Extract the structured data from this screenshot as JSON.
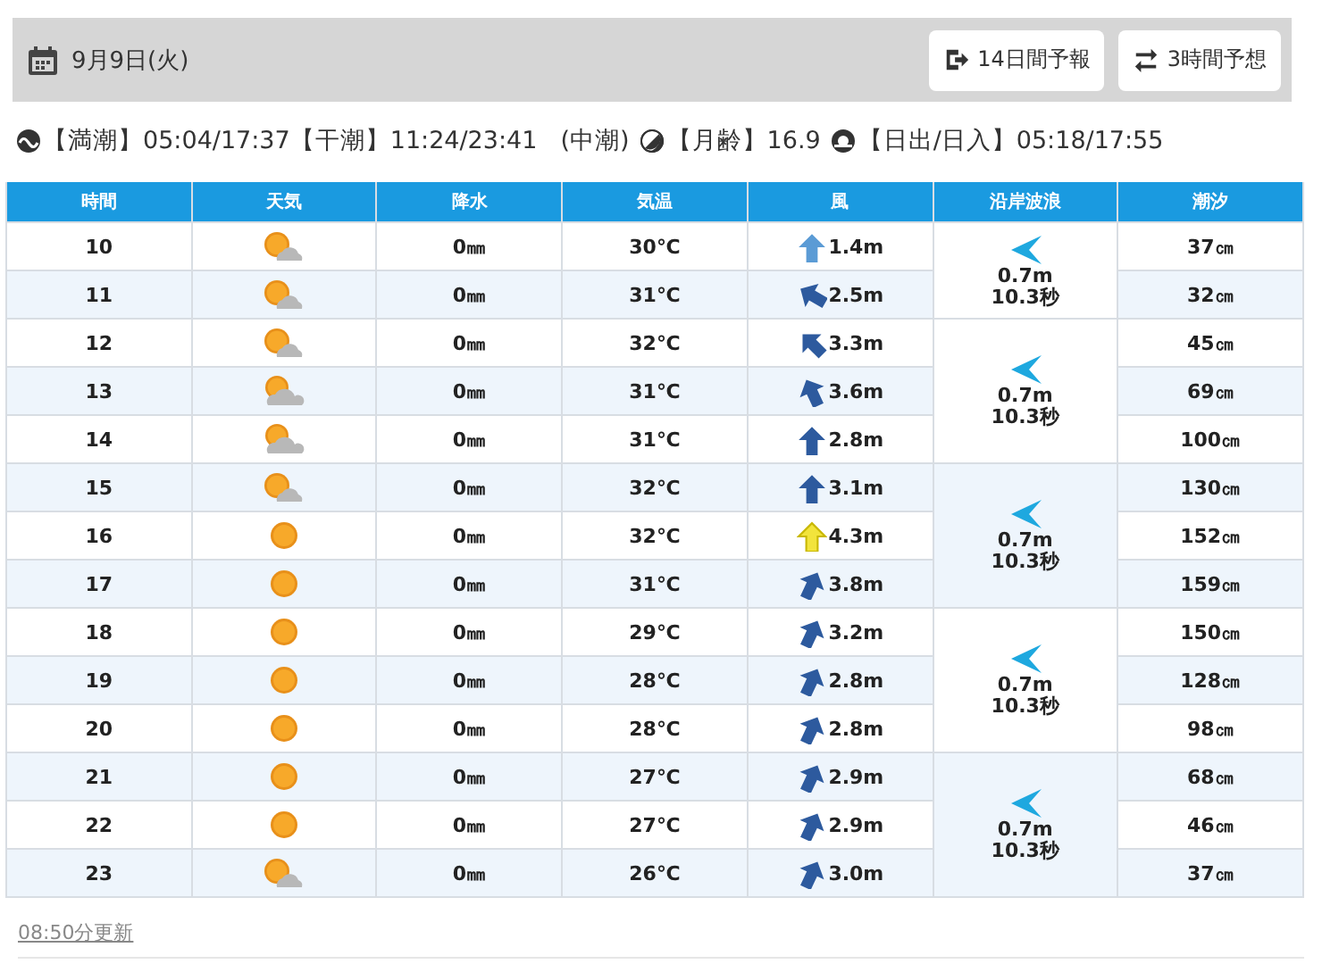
{
  "header": {
    "date": "9月9日(火)",
    "buttons": [
      {
        "label": "14日間予報",
        "kind": "exit"
      },
      {
        "label": "3時間予想",
        "kind": "swap"
      }
    ]
  },
  "tide_info": [
    {
      "kind": "tide",
      "texts": [
        "【満潮】05:04/17:37【干潮】11:24/23:41",
        "(中潮)"
      ]
    },
    {
      "kind": "moon",
      "texts": [
        "【月齢】16.9"
      ]
    },
    {
      "kind": "sun",
      "texts": [
        "【日出/日入】05:18/17:55"
      ]
    }
  ],
  "table": {
    "columns": [
      "時間",
      "天気",
      "降水",
      "気温",
      "風",
      "沿岸波浪",
      "潮汐"
    ],
    "wave_groups": [
      {
        "height": "0.7m",
        "period": "10.3秒",
        "rows": [
          {
            "time": "10",
            "kind": "suncloud",
            "rain": "0㎜",
            "temp": "30℃",
            "wind": {
              "kind": "n",
              "color": "#5b9bd5",
              "speed": "1.4m"
            },
            "tide": "37㎝"
          },
          {
            "time": "11",
            "kind": "suncloud",
            "rain": "0㎜",
            "temp": "31℃",
            "wind": {
              "kind": "wnw",
              "color": "#2d5a9e",
              "speed": "2.5m"
            },
            "tide": "32㎝"
          }
        ]
      },
      {
        "height": "0.7m",
        "period": "10.3秒",
        "rows": [
          {
            "time": "12",
            "kind": "suncloud",
            "rain": "0㎜",
            "temp": "32℃",
            "wind": {
              "kind": "nw",
              "color": "#2d5a9e",
              "speed": "3.3m"
            },
            "tide": "45㎝"
          },
          {
            "time": "13",
            "kind": "cloudsun",
            "rain": "0㎜",
            "temp": "31℃",
            "wind": {
              "kind": "nnw",
              "color": "#2d5a9e",
              "speed": "3.6m"
            },
            "tide": "69㎝"
          },
          {
            "time": "14",
            "kind": "cloudsun",
            "rain": "0㎜",
            "temp": "31℃",
            "wind": {
              "kind": "n",
              "color": "#2d5a9e",
              "speed": "2.8m"
            },
            "tide": "100㎝"
          }
        ]
      },
      {
        "height": "0.7m",
        "period": "10.3秒",
        "rows": [
          {
            "time": "15",
            "kind": "suncloud",
            "rain": "0㎜",
            "temp": "32℃",
            "wind": {
              "kind": "n",
              "color": "#2d5a9e",
              "speed": "3.1m"
            },
            "tide": "130㎝"
          },
          {
            "time": "16",
            "kind": "sun",
            "rain": "0㎜",
            "temp": "32℃",
            "wind": {
              "kind": "n",
              "color": "#f2e43c",
              "speed": "4.3m"
            },
            "tide": "152㎝"
          },
          {
            "time": "17",
            "kind": "sun",
            "rain": "0㎜",
            "temp": "31℃",
            "wind": {
              "kind": "nne",
              "color": "#2d5a9e",
              "speed": "3.8m"
            },
            "tide": "159㎝"
          }
        ]
      },
      {
        "height": "0.7m",
        "period": "10.3秒",
        "rows": [
          {
            "time": "18",
            "kind": "sun",
            "rain": "0㎜",
            "temp": "29℃",
            "wind": {
              "kind": "nne",
              "color": "#2d5a9e",
              "speed": "3.2m"
            },
            "tide": "150㎝"
          },
          {
            "time": "19",
            "kind": "sun",
            "rain": "0㎜",
            "temp": "28℃",
            "wind": {
              "kind": "nne",
              "color": "#2d5a9e",
              "speed": "2.8m"
            },
            "tide": "128㎝"
          },
          {
            "time": "20",
            "kind": "sun",
            "rain": "0㎜",
            "temp": "28℃",
            "wind": {
              "kind": "nne",
              "color": "#2d5a9e",
              "speed": "2.8m"
            },
            "tide": "98㎝"
          }
        ]
      },
      {
        "height": "0.7m",
        "period": "10.3秒",
        "rows": [
          {
            "time": "21",
            "kind": "sun",
            "rain": "0㎜",
            "temp": "27℃",
            "wind": {
              "kind": "nne",
              "color": "#2d5a9e",
              "speed": "2.9m"
            },
            "tide": "68㎝"
          },
          {
            "time": "22",
            "kind": "sun",
            "rain": "0㎜",
            "temp": "27℃",
            "wind": {
              "kind": "nne",
              "color": "#2d5a9e",
              "speed": "2.9m"
            },
            "tide": "46㎝"
          },
          {
            "time": "23",
            "kind": "suncloud",
            "rain": "0㎜",
            "temp": "26℃",
            "wind": {
              "kind": "nne",
              "color": "#2d5a9e",
              "speed": "3.0m"
            },
            "tide": "37㎝"
          }
        ]
      }
    ]
  },
  "footer": {
    "updated": "08:50分更新"
  }
}
